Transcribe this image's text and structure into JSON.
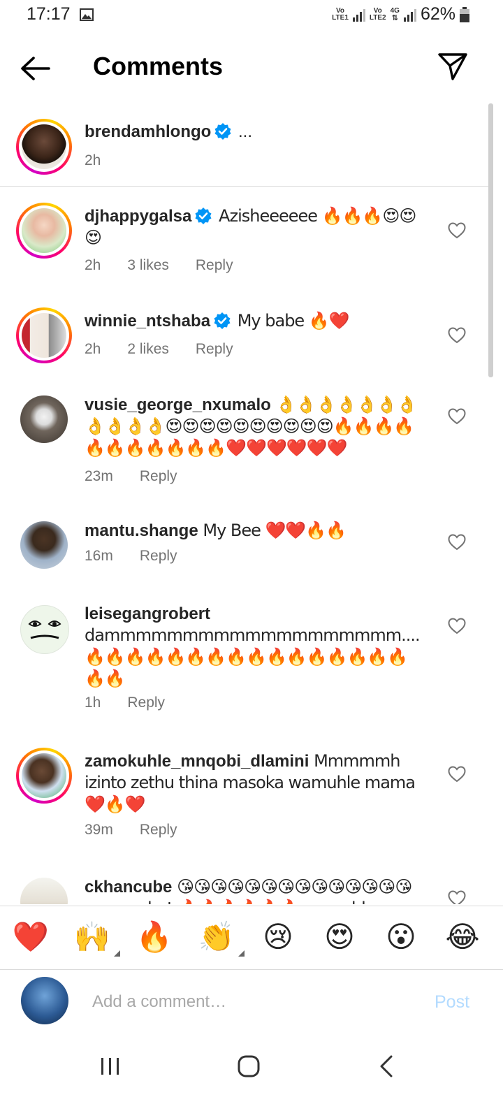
{
  "status_bar": {
    "time": "17:17",
    "sim1_top": "Vo",
    "sim1_bottom": "LTE1",
    "sim2_top": "Vo",
    "sim2_bottom": "LTE2",
    "network": "4G",
    "battery": "62%"
  },
  "header": {
    "title": "Comments",
    "back_icon": "arrow-left-icon",
    "send_icon": "paper-plane-icon"
  },
  "caption": {
    "username": "brendamhlongo",
    "text": "...",
    "time": "2h",
    "verified": true
  },
  "comments": [
    {
      "username": "djhappygalsa",
      "verified": true,
      "text": "Azisheeeeee 🔥🔥🔥😍😍😍",
      "time": "2h",
      "likes": "3 likes",
      "reply": "Reply"
    },
    {
      "username": "winnie_ntshaba",
      "verified": true,
      "text": "My babe 🔥❤️",
      "time": "2h",
      "likes": "2 likes",
      "reply": "Reply"
    },
    {
      "username": "vusie_george_nxumalo",
      "verified": false,
      "text": "👌👌👌👌👌👌👌👌👌👌👌😍😍😍😍😍😍😍😍😍😍🔥🔥🔥🔥🔥🔥🔥🔥🔥🔥🔥❤️❤️❤️❤️❤️❤️",
      "time": "23m",
      "likes": "",
      "reply": "Reply"
    },
    {
      "username": "mantu.shange",
      "verified": false,
      "text": "My Bee ❤️❤️🔥🔥",
      "time": "16m",
      "likes": "",
      "reply": "Reply"
    },
    {
      "username": "leisegangrobert",
      "verified": false,
      "text": "dammmmmmmmmmmmmmmmmmm....🔥🔥🔥🔥🔥🔥🔥🔥🔥🔥🔥🔥🔥🔥🔥🔥🔥🔥",
      "time": "1h",
      "likes": "",
      "reply": "Reply"
    },
    {
      "username": "zamokuhle_mnqobi_dlamini",
      "verified": false,
      "text": "Mmmmmh izinto zethu thina masoka wamuhle mama ❤️🔥❤️",
      "time": "39m",
      "likes": "",
      "reply": "Reply"
    },
    {
      "username": "ckhancube",
      "verified": false,
      "text": "😘😘😘😘😘😘😘😘😘😘😘😘😘😘 you are hot 🔥🔥🔥🔥🔥🔥 wamuhle",
      "time": "",
      "likes": "",
      "reply": ""
    }
  ],
  "quick_emojis": [
    "❤️",
    "🙌",
    "🔥",
    "👏",
    "😢",
    "😍",
    "😮",
    "😂"
  ],
  "input": {
    "placeholder": "Add a comment…",
    "value": "",
    "post_label": "Post"
  },
  "colors": {
    "story_ring_start": "#d300c5",
    "story_ring_end": "#ffd600",
    "verified_blue": "#0095f6",
    "meta_gray": "#737373",
    "post_disabled": "#b3dbff"
  }
}
